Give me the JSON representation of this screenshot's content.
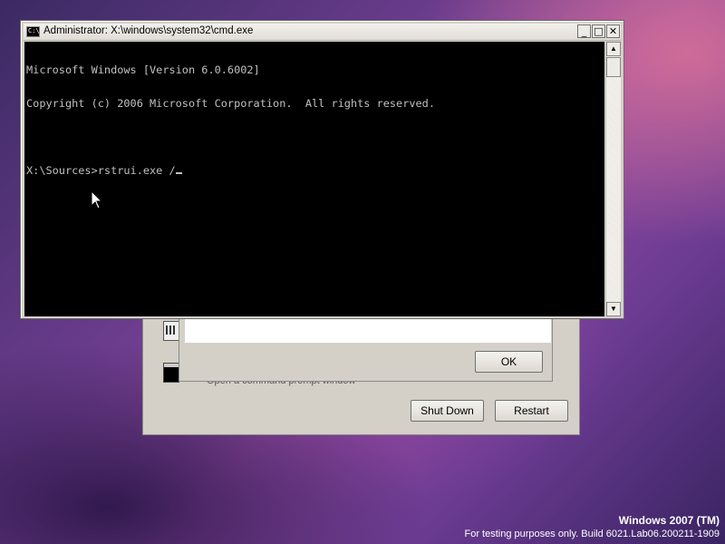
{
  "recovery_dialog": {
    "shutdown_label": "Shut Down",
    "restart_label": "Restart",
    "command_prompt_description": "Open a command prompt window"
  },
  "message_box": {
    "ok_label": "OK"
  },
  "cmd_window": {
    "title": "Administrator: X:\\windows\\system32\\cmd.exe",
    "icon_text": "C:\\",
    "lines": [
      "Microsoft Windows [Version 6.0.6002]",
      "Copyright (c) 2006 Microsoft Corporation.  All rights reserved.",
      "",
      "X:\\Sources>rstrui.exe /"
    ],
    "minimize_glyph": "_",
    "maximize_glyph": "□",
    "close_glyph": "✕",
    "scroll_up_glyph": "▲",
    "scroll_down_glyph": "▼"
  },
  "watermark": {
    "title": "Windows 2007 (TM)",
    "build": "For testing purposes only. Build 6021.Lab06.200211-1909"
  },
  "colors": {
    "console_background": "#000000",
    "console_text": "#c0c0c0",
    "dialog_face": "#d4d0c8"
  },
  "icons": [
    "cmd-icon",
    "minimize-icon",
    "maximize-icon",
    "close-icon",
    "scroll-up-icon",
    "scroll-down-icon",
    "memory-diagnostic-icon",
    "command-prompt-icon",
    "mouse-pointer-icon"
  ]
}
